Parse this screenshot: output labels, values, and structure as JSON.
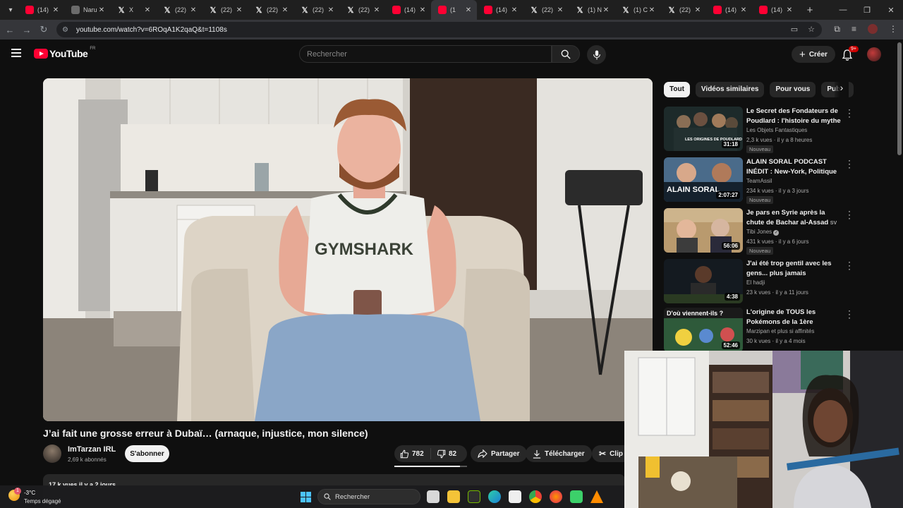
{
  "browser": {
    "tabs": [
      {
        "title": "(14)",
        "icon": "youtube"
      },
      {
        "title": "Naru",
        "icon": "page"
      },
      {
        "title": "X",
        "icon": "x"
      },
      {
        "title": "(22)",
        "icon": "x"
      },
      {
        "title": "(22)",
        "icon": "x"
      },
      {
        "title": "(22)",
        "icon": "x"
      },
      {
        "title": "(22)",
        "icon": "x"
      },
      {
        "title": "(22)",
        "icon": "x"
      },
      {
        "title": "(14)",
        "icon": "youtube"
      },
      {
        "title": "(1",
        "icon": "youtube",
        "active": true
      },
      {
        "title": "(14)",
        "icon": "youtube"
      },
      {
        "title": "(22)",
        "icon": "x"
      },
      {
        "title": "(1) N",
        "icon": "x"
      },
      {
        "title": "(1) C",
        "icon": "x"
      },
      {
        "title": "(22)",
        "icon": "x"
      },
      {
        "title": "(14)",
        "icon": "youtube"
      },
      {
        "title": "(14)",
        "icon": "youtube"
      }
    ],
    "url": "youtube.com/watch?v=6ROqA1K2qaQ&t=1108s"
  },
  "header": {
    "logo_text": "YouTube",
    "country_code": "FR",
    "search_placeholder": "Rechercher",
    "create_label": "Créer",
    "notif_count": "9+"
  },
  "video": {
    "title": "J’ai fait une grosse erreur à Dubaï… (arnaque, injustice, mon silence)",
    "channel": "ImTarzan IRL",
    "subscribers": "2,69 k abonnés",
    "subscribe_label": "S'abonner",
    "likes": "782",
    "dislikes": "82",
    "like_ratio": 0.905,
    "share_label": "Partager",
    "download_label": "Télécharger",
    "clip_label": "Clip",
    "desc_meta": "17 k vues  il y a 2 jours",
    "shirt_text": "GYMSHARK"
  },
  "sidebar": {
    "chips": [
      "Tout",
      "Vidéos similaires",
      "Pour vous",
      "Publié"
    ],
    "recs": [
      {
        "title": "Le Secret des Fondateurs de Poudlard : l'histoire du mythe ...",
        "channel": "Les Objets Fantastiques",
        "meta": "2,3 k vues · il y a 8 heures",
        "badge": "Nouveau",
        "duration": "31:18",
        "thumb_text": "LES ORIGINES DE POUDLARD"
      },
      {
        "title": "ALAIN SORAL PODCAST INÉDIT : New-York, Politique Français...",
        "channel": "TeamAssil",
        "meta": "234 k vues · il y a 3 jours",
        "badge": "Nouveau",
        "duration": "2:07:27",
        "thumb_text": "ALAIN SORAL"
      },
      {
        "title": "Je pars en Syrie après la chute de Bachar al-Assad",
        "title_suffix": "SV",
        "channel": "Tibi Jones",
        "meta": "431 k vues · il y a 6 jours",
        "badge": "Nouveau",
        "duration": "56:06"
      },
      {
        "title": "J'ai été trop gentil avec les gens... plus jamais",
        "channel": "El hadji",
        "meta": "23 k vues · il y a 11 jours",
        "badge": "",
        "duration": "4:38"
      },
      {
        "title": "L'origine de TOUS les Pokémons de la 1ère génération",
        "channel": "Marzipan et plus si affinités",
        "meta": "30 k vues · il y a 4 mois",
        "badge": "",
        "duration": "52:46",
        "thumb_text": "D'où viennent-ils ?"
      }
    ]
  },
  "taskbar": {
    "temperature": "-3°C",
    "weather": "Temps dégagé",
    "weather_badge": "1",
    "search_label": "Rechercher"
  },
  "colors": {
    "yt_red": "#ff0033",
    "bg": "#0f0f0f",
    "surface": "#272727"
  }
}
